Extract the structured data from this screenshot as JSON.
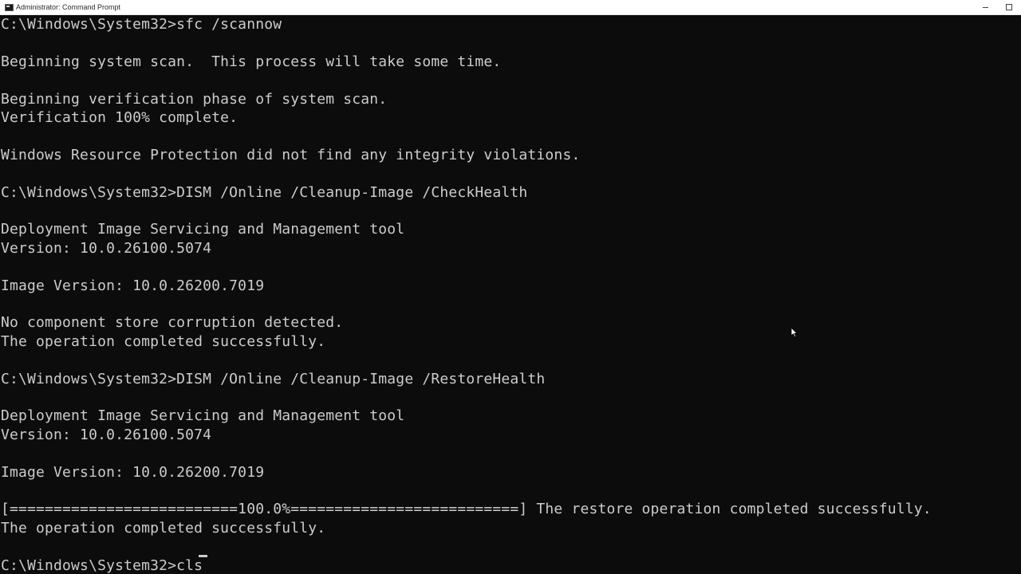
{
  "window": {
    "title": "Administrator: Command Prompt"
  },
  "titlebar": {
    "minimize": "minimize",
    "maximize": "maximize"
  },
  "console": {
    "lines": [
      "C:\\Windows\\System32>sfc /scannow",
      "",
      "Beginning system scan.  This process will take some time.",
      "",
      "Beginning verification phase of system scan.",
      "Verification 100% complete.",
      "",
      "Windows Resource Protection did not find any integrity violations.",
      "",
      "C:\\Windows\\System32>DISM /Online /Cleanup-Image /CheckHealth",
      "",
      "Deployment Image Servicing and Management tool",
      "Version: 10.0.26100.5074",
      "",
      "Image Version: 10.0.26200.7019",
      "",
      "No component store corruption detected.",
      "The operation completed successfully.",
      "",
      "C:\\Windows\\System32>DISM /Online /Cleanup-Image /RestoreHealth",
      "",
      "Deployment Image Servicing and Management tool",
      "Version: 10.0.26100.5074",
      "",
      "Image Version: 10.0.26200.7019",
      "",
      "[==========================100.0%==========================] The restore operation completed successfully.",
      "The operation completed successfully.",
      "",
      "C:\\Windows\\System32>cls"
    ]
  },
  "colors": {
    "background": "#0c0c0c",
    "foreground": "#cccccc",
    "titlebar": "#ffffff"
  }
}
